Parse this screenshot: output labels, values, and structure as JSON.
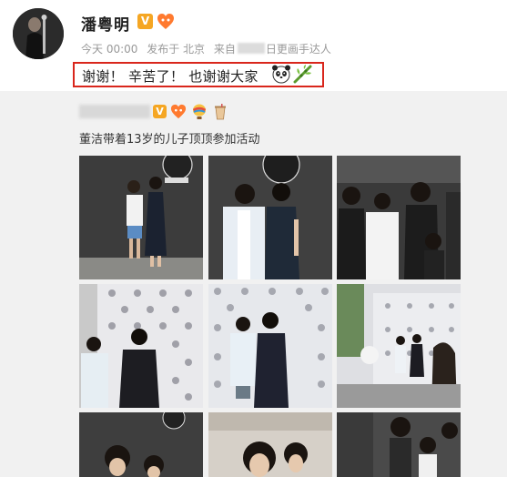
{
  "post": {
    "username": "潘粤明",
    "verified_label": "V",
    "meta": {
      "time": "今天 00:00",
      "location": "发布于 北京",
      "source_prefix": "来自",
      "source_suffix": "日更画手达人"
    },
    "text": "谢谢！ 辛苦了！ 也谢谢大家",
    "emojis": [
      "panda-emoji",
      "bamboo-emoji"
    ]
  },
  "repost": {
    "verified_label": "V",
    "text": "董洁带着13岁的儿子顶顶参加活动",
    "badges": [
      "fan-badge-icon",
      "hot-air-balloon-icon",
      "drink-cup-icon"
    ]
  },
  "photos": [
    {
      "scene": "black-wall-two-people"
    },
    {
      "scene": "black-wall-two-people-close"
    },
    {
      "scene": "crowd-group"
    },
    {
      "scene": "logo-backdrop-two-people"
    },
    {
      "scene": "logo-backdrop-two-people-center"
    },
    {
      "scene": "logo-backdrop-wide"
    },
    {
      "scene": "partial-bottom-1"
    },
    {
      "scene": "partial-bottom-2"
    },
    {
      "scene": "partial-bottom-3"
    }
  ],
  "colors": {
    "highlight_border": "#d9261c",
    "verified_badge": "#f5a623",
    "meta_text": "#999999",
    "background": "#f1f1f1"
  }
}
